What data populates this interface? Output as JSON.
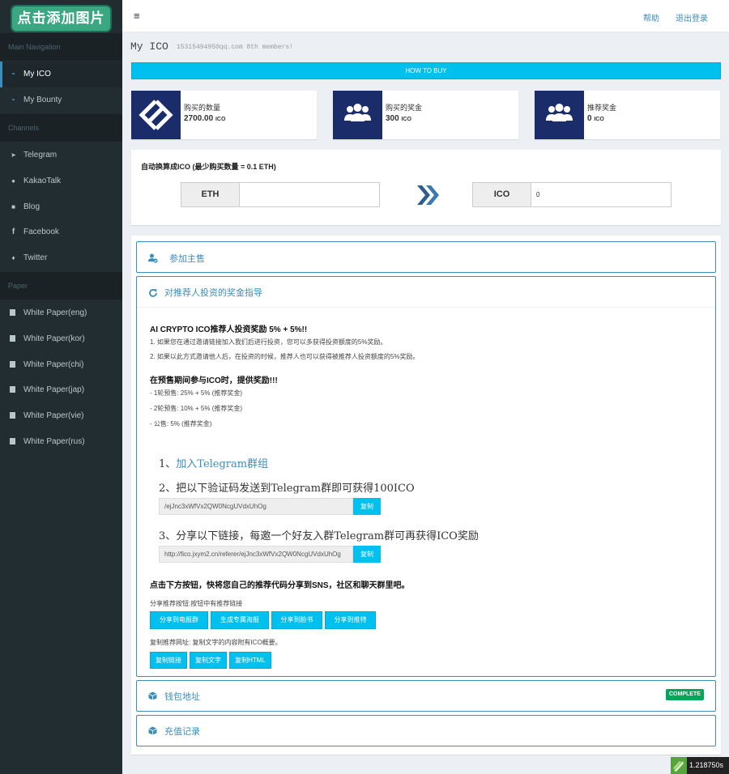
{
  "logo": {
    "text": "点击添加图片"
  },
  "sidebar": {
    "main_header": "Main Navigation",
    "main_items": [
      {
        "label": "My ICO",
        "icon": "dashboard-icon"
      },
      {
        "label": "My Bounty",
        "icon": "dashboard-icon"
      }
    ],
    "channels_header": "Channels",
    "channel_items": [
      {
        "label": "Telegram",
        "icon": "telegram-icon"
      },
      {
        "label": "KakaoTalk",
        "icon": "chat-icon"
      },
      {
        "label": "Blog",
        "icon": "blog-icon"
      },
      {
        "label": "Facebook",
        "icon": "facebook-icon"
      },
      {
        "label": "Twitter",
        "icon": "twitter-icon"
      }
    ],
    "paper_header": "Paper",
    "paper_items": [
      {
        "label": "White Paper(eng)"
      },
      {
        "label": "White Paper(kor)"
      },
      {
        "label": "White Paper(chi)"
      },
      {
        "label": "White Paper(jap)"
      },
      {
        "label": "White Paper(vie)"
      },
      {
        "label": "White Paper(rus)"
      }
    ]
  },
  "topbar": {
    "menu_icon": "≡",
    "help": "帮助",
    "logout": "退出登录"
  },
  "page": {
    "title": "My ICO",
    "subtitle": "15315494950qq.com 8th members!"
  },
  "how_to_buy": "HOW TO BUY",
  "infoboxes": [
    {
      "label": "购买的数量",
      "value": "2700.00",
      "unit": "ICO",
      "icon": "logo-icon"
    },
    {
      "label": "购买的奖金",
      "value": "300",
      "unit": "ICO",
      "icon": "users-icon"
    },
    {
      "label": "推荐奖金",
      "value": "0",
      "unit": "ICO",
      "icon": "users-icon"
    }
  ],
  "converter": {
    "title": "自动换算成ICO (最少购买数量 = 0.1 ETH)",
    "eth_label": "ETH",
    "eth_value": "",
    "ico_label": "ICO",
    "ico_value": "0"
  },
  "panels": {
    "join": {
      "title": "参加主售"
    },
    "referral": {
      "title": "对推荐人投资的奖金指导",
      "heading1": "AI CRYPTO ICO推荐人投资奖励 5% + 5%!!",
      "line1": "1. 如果您在通过邀请链接加入我们后进行投资，您可以多获得投资额度的5%奖励。",
      "line2": "2. 如果以此方式邀请他人后，在投资的时候，推荐人也可以获得被推荐人投资额度的5%奖励。",
      "heading2": "在预售期间参与ICO时，提供奖励!!!",
      "bonus1": "- 1轮预售: 25% + 5% (推荐奖金)",
      "bonus2": "- 2轮预售: 10% + 5% (推荐奖金)",
      "bonus3": "- 公售: 5% (推荐奖金)",
      "step1_prefix": "1、",
      "step1_link": "加入Telegram群组",
      "step2": "2、把以下验证码发送到Telegram群即可获得100ICO",
      "code_value": "/ejJnc3xWfVx2QW0NcgUVdxUhOg",
      "copy_label": "复制",
      "step3": "3、分享以下链接，每邀一个好友入群Telegram群可再获得ICO奖励",
      "link_value": "http://fico.jxym2.cn/referer/ejJnc3xWfVx2QW0NcgUVdxUhOg",
      "share_heading": "点击下方按钮，快将您自己的推荐代码分享到SNS，社区和聊天群里吧。",
      "share_desc": "分享推荐按钮:按钮中有推荐链接",
      "share_buttons": [
        "分享到电报群",
        "生成专属海报",
        "分享到脸书",
        "分享到推特"
      ],
      "copy_desc": "复制推荐网址: 复制文字的内容附有ICO概要。",
      "copy_buttons": [
        "复制链接",
        "复制文字",
        "复制HTML"
      ]
    },
    "wallet": {
      "title": "钱包地址",
      "badge": "COMPLETE"
    },
    "recharge": {
      "title": "充值记录"
    }
  },
  "footer": {
    "timer": "1.218750s"
  }
}
